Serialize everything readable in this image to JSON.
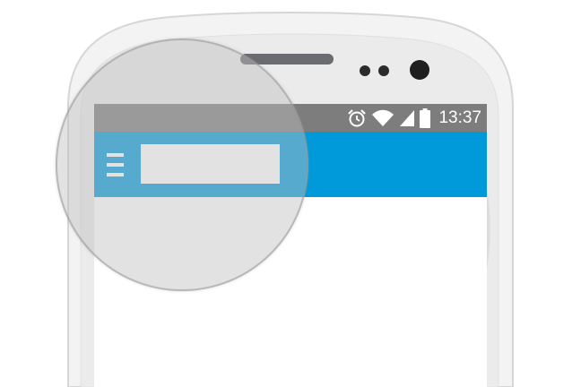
{
  "status_bar": {
    "time": "13:37",
    "icons": [
      "alarm-icon",
      "wifi-icon",
      "cellular-signal-icon",
      "battery-icon"
    ],
    "background": "#7d7d7d"
  },
  "action_bar": {
    "background": "#0099d9",
    "menu_icon": "hamburger-menu-icon",
    "title": ""
  },
  "device": {
    "speaker": "earpiece-speaker",
    "sensors": [
      "proximity-sensor",
      "front-camera"
    ]
  },
  "overlay": {
    "type": "magnifier-circle"
  }
}
